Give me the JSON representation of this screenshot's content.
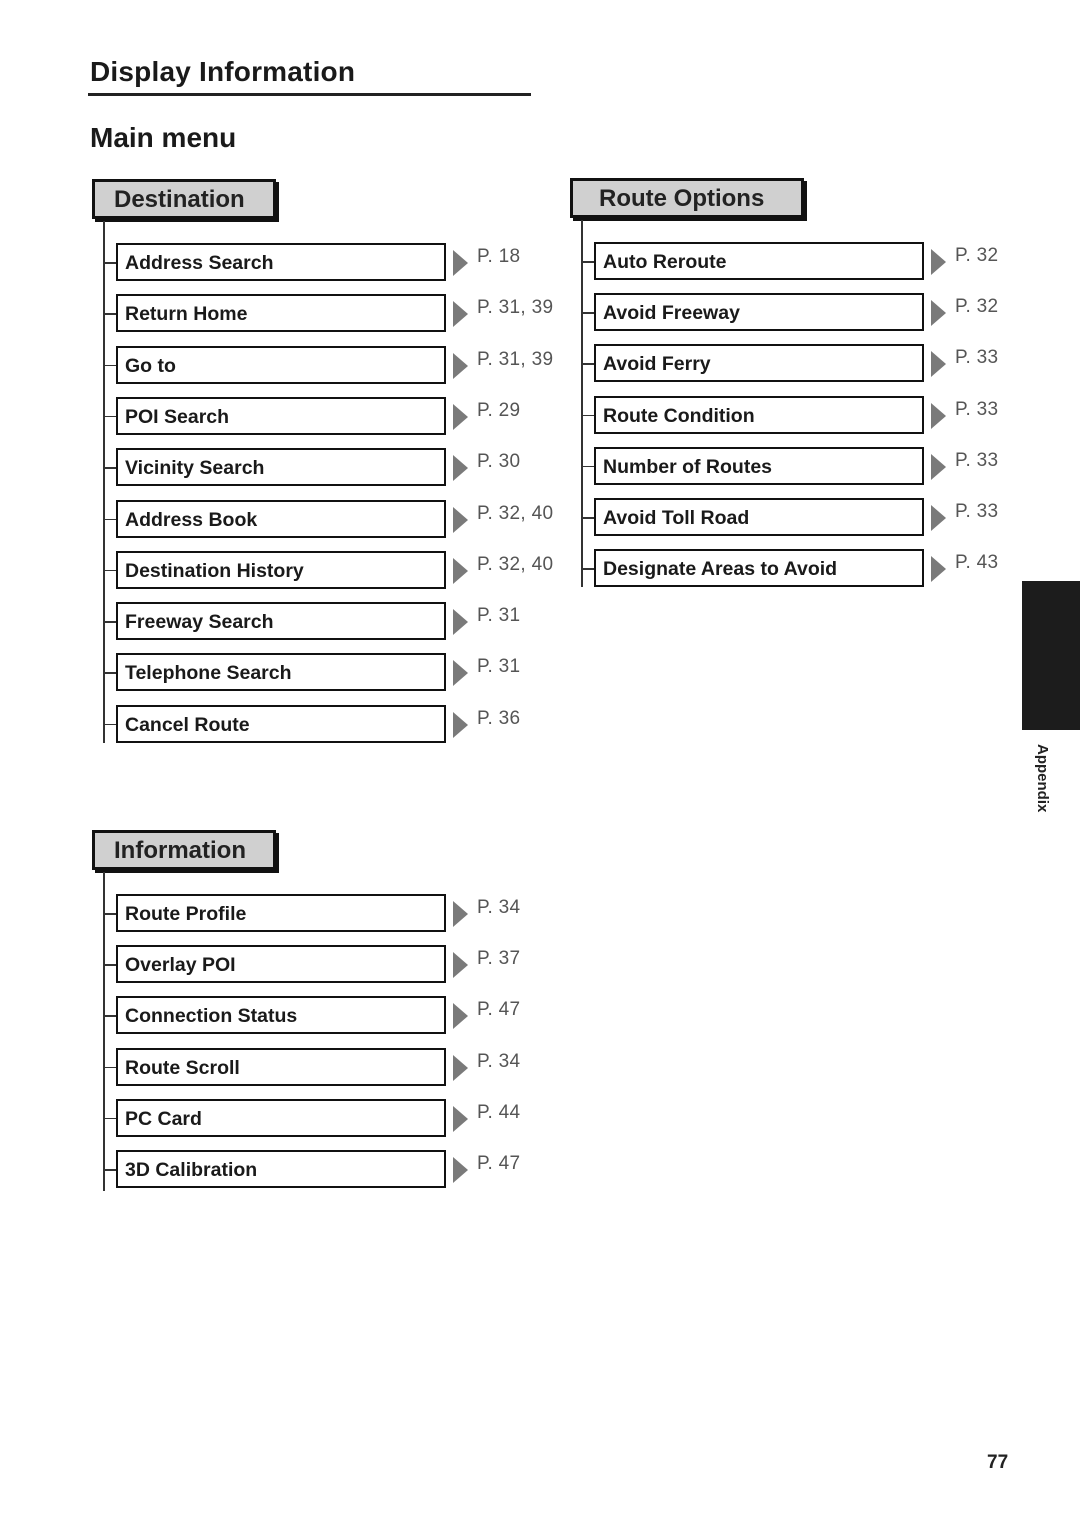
{
  "document": {
    "title": "Display Information",
    "subtitle": "Main menu",
    "side_tab_label": "Appendix",
    "page_number": "77"
  },
  "sections": {
    "destination": {
      "header": "Destination",
      "items": [
        {
          "label": "Address Search",
          "page": "P. 18"
        },
        {
          "label": "Return Home",
          "page": "P. 31, 39"
        },
        {
          "label": "Go to",
          "page": "P. 31, 39"
        },
        {
          "label": "POI Search",
          "page": "P. 29"
        },
        {
          "label": "Vicinity Search",
          "page": "P. 30"
        },
        {
          "label": "Address Book",
          "page": "P. 32, 40"
        },
        {
          "label": "Destination History",
          "page": "P. 32, 40"
        },
        {
          "label": "Freeway Search",
          "page": "P. 31"
        },
        {
          "label": "Telephone Search",
          "page": "P. 31"
        },
        {
          "label": "Cancel Route",
          "page": "P. 36"
        }
      ]
    },
    "route_options": {
      "header": "Route Options",
      "items": [
        {
          "label": "Auto Reroute",
          "page": "P. 32"
        },
        {
          "label": "Avoid Freeway",
          "page": "P. 32"
        },
        {
          "label": "Avoid Ferry",
          "page": "P. 33"
        },
        {
          "label": "Route Condition",
          "page": "P. 33"
        },
        {
          "label": "Number of Routes",
          "page": "P. 33"
        },
        {
          "label": "Avoid Toll Road",
          "page": "P. 33"
        },
        {
          "label": "Designate Areas to Avoid",
          "page": "P. 43"
        }
      ]
    },
    "information": {
      "header": "Information",
      "items": [
        {
          "label": "Route Profile",
          "page": "P. 34"
        },
        {
          "label": "Overlay POI",
          "page": "P. 37"
        },
        {
          "label": "Connection Status",
          "page": "P. 47"
        },
        {
          "label": "Route Scroll",
          "page": "P. 34"
        },
        {
          "label": "PC Card",
          "page": "P. 44"
        },
        {
          "label": "3D Calibration",
          "page": "P. 47"
        }
      ]
    }
  },
  "colors": {
    "header_fill": "#d0d0d0",
    "arrow": "#7a7a7a",
    "side_tab": "#1c1c1c"
  }
}
